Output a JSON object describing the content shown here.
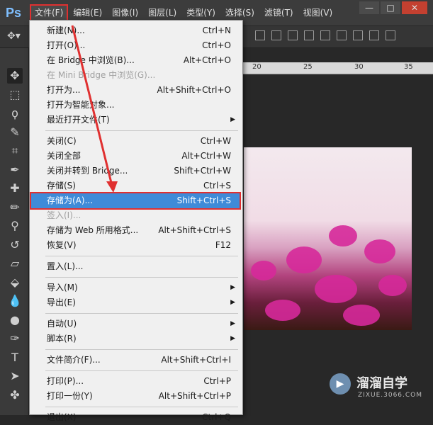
{
  "app": {
    "logo": "Ps"
  },
  "menubar": [
    {
      "id": "file",
      "label": "文件(F)",
      "active": true
    },
    {
      "id": "edit",
      "label": "编辑(E)"
    },
    {
      "id": "image",
      "label": "图像(I)"
    },
    {
      "id": "layer",
      "label": "图层(L)"
    },
    {
      "id": "type",
      "label": "类型(Y)"
    },
    {
      "id": "select",
      "label": "选择(S)"
    },
    {
      "id": "filter",
      "label": "滤镜(T)"
    },
    {
      "id": "view",
      "label": "视图(V)"
    }
  ],
  "window_controls": {
    "minimize": "—",
    "restore": "□",
    "close": "✕"
  },
  "ruler": {
    "ticks": [
      "20",
      "25",
      "30",
      "35"
    ]
  },
  "tools": [
    {
      "name": "move-tool-icon",
      "glyph": "✥"
    },
    {
      "name": "marquee-tool-icon",
      "glyph": "⬚"
    },
    {
      "name": "lasso-tool-icon",
      "glyph": "ϙ"
    },
    {
      "name": "quick-select-tool-icon",
      "glyph": "✎"
    },
    {
      "name": "crop-tool-icon",
      "glyph": "⌗"
    },
    {
      "name": "eyedropper-tool-icon",
      "glyph": "✒"
    },
    {
      "name": "healing-brush-tool-icon",
      "glyph": "✚"
    },
    {
      "name": "brush-tool-icon",
      "glyph": "✏"
    },
    {
      "name": "clone-stamp-tool-icon",
      "glyph": "⚲"
    },
    {
      "name": "history-brush-tool-icon",
      "glyph": "↺"
    },
    {
      "name": "eraser-tool-icon",
      "glyph": "▱"
    },
    {
      "name": "paint-bucket-tool-icon",
      "glyph": "⬙"
    },
    {
      "name": "blur-tool-icon",
      "glyph": "💧"
    },
    {
      "name": "dodge-tool-icon",
      "glyph": "●"
    },
    {
      "name": "pen-tool-icon",
      "glyph": "✑"
    },
    {
      "name": "type-tool-icon",
      "glyph": "T"
    },
    {
      "name": "path-select-tool-icon",
      "glyph": "➤"
    },
    {
      "name": "shape-tool-icon",
      "glyph": "✤"
    }
  ],
  "file_menu": {
    "items": [
      {
        "label": "新建(N)...",
        "shortcut": "Ctrl+N"
      },
      {
        "label": "打开(O)...",
        "shortcut": "Ctrl+O"
      },
      {
        "label": "在 Bridge 中浏览(B)...",
        "shortcut": "Alt+Ctrl+O"
      },
      {
        "label": "在 Mini Bridge 中浏览(G)...",
        "shortcut": "",
        "disabled": true
      },
      {
        "label": "打开为...",
        "shortcut": "Alt+Shift+Ctrl+O"
      },
      {
        "label": "打开为智能对象...",
        "shortcut": ""
      },
      {
        "label": "最近打开文件(T)",
        "shortcut": "",
        "submenu": true
      },
      {
        "sep": true
      },
      {
        "label": "关闭(C)",
        "shortcut": "Ctrl+W"
      },
      {
        "label": "关闭全部",
        "shortcut": "Alt+Ctrl+W"
      },
      {
        "label": "关闭并转到 Bridge...",
        "shortcut": "Shift+Ctrl+W"
      },
      {
        "label": "存储(S)",
        "shortcut": "Ctrl+S"
      },
      {
        "label": "存储为(A)...",
        "shortcut": "Shift+Ctrl+S",
        "highlighted": true
      },
      {
        "label": "签入(I)...",
        "shortcut": "",
        "disabled": true
      },
      {
        "label": "存储为 Web 所用格式...",
        "shortcut": "Alt+Shift+Ctrl+S"
      },
      {
        "label": "恢复(V)",
        "shortcut": "F12"
      },
      {
        "sep": true
      },
      {
        "label": "置入(L)...",
        "shortcut": ""
      },
      {
        "sep": true
      },
      {
        "label": "导入(M)",
        "shortcut": "",
        "submenu": true
      },
      {
        "label": "导出(E)",
        "shortcut": "",
        "submenu": true
      },
      {
        "sep": true
      },
      {
        "label": "自动(U)",
        "shortcut": "",
        "submenu": true
      },
      {
        "label": "脚本(R)",
        "shortcut": "",
        "submenu": true
      },
      {
        "sep": true
      },
      {
        "label": "文件简介(F)...",
        "shortcut": "Alt+Shift+Ctrl+I"
      },
      {
        "sep": true
      },
      {
        "label": "打印(P)...",
        "shortcut": "Ctrl+P"
      },
      {
        "label": "打印一份(Y)",
        "shortcut": "Alt+Shift+Ctrl+P"
      },
      {
        "sep": true
      },
      {
        "label": "退出(X)",
        "shortcut": "Ctrl+Q"
      }
    ]
  },
  "watermark": {
    "icon": "▶",
    "title": "溜溜自学",
    "subtitle": "ZIXUE.3066.COM"
  },
  "colors": {
    "highlight": "#3f8bd8",
    "annotation": "#e03030"
  }
}
